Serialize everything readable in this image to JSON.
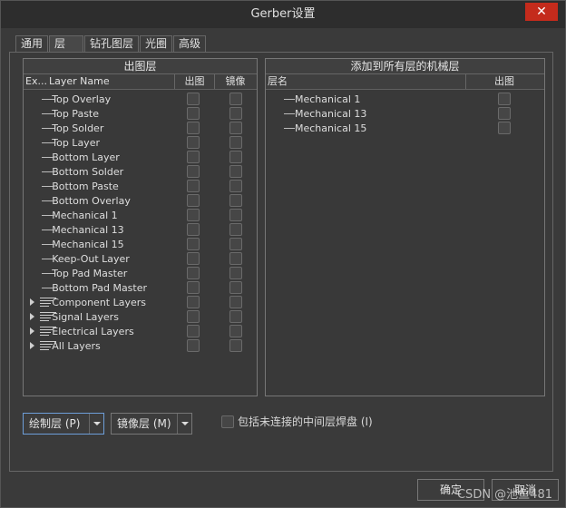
{
  "window": {
    "title": "Gerber设置",
    "close": "✕"
  },
  "tabs": [
    "通用",
    "层",
    "钻孔图层",
    "光圈",
    "高级"
  ],
  "left_panel": {
    "title": "出图层",
    "columns": {
      "expand": "Ex...",
      "name": "Layer Name",
      "plot": "出图",
      "mirror": "镜像"
    },
    "layers": [
      {
        "name": "Top Overlay",
        "group": false
      },
      {
        "name": "Top Paste",
        "group": false
      },
      {
        "name": "Top Solder",
        "group": false
      },
      {
        "name": "Top Layer",
        "group": false
      },
      {
        "name": "Bottom Layer",
        "group": false
      },
      {
        "name": "Bottom Solder",
        "group": false
      },
      {
        "name": "Bottom Paste",
        "group": false
      },
      {
        "name": "Bottom Overlay",
        "group": false
      },
      {
        "name": "Mechanical 1",
        "group": false
      },
      {
        "name": "Mechanical 13",
        "group": false
      },
      {
        "name": "Mechanical 15",
        "group": false
      },
      {
        "name": "Keep-Out Layer",
        "group": false
      },
      {
        "name": "Top Pad Master",
        "group": false
      },
      {
        "name": "Bottom Pad Master",
        "group": false
      },
      {
        "name": "Component Layers",
        "group": true
      },
      {
        "name": "Signal Layers",
        "group": true
      },
      {
        "name": "Electrical Layers",
        "group": true
      },
      {
        "name": "All Layers",
        "group": true
      }
    ]
  },
  "right_panel": {
    "title": "添加到所有层的机械层",
    "columns": {
      "name": "层名",
      "plot": "出图"
    },
    "layers": [
      "Mechanical 1",
      "Mechanical 13",
      "Mechanical 15"
    ]
  },
  "controls": {
    "plot_layers": "绘制层 (P)",
    "mirror_layers": "镜像层 (M)",
    "include_unconnected": "包括未连接的中间层焊盘 (I)"
  },
  "footer": {
    "ok": "确定",
    "cancel": "取消"
  },
  "watermark": "CSDN @池鱼481"
}
